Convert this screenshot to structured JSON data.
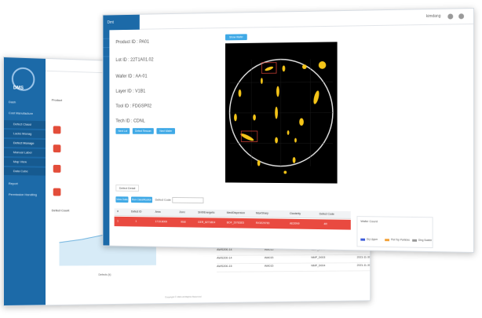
{
  "back_window": {
    "logo_text": "DMS",
    "nav": [
      {
        "label": "Dash"
      },
      {
        "label": "Cost Manufacture",
        "selected": false
      },
      {
        "label": "Defect Classi"
      },
      {
        "label": "Lacks Manag"
      },
      {
        "label": "Defect Manage",
        "selected": true
      },
      {
        "label": "Manual Label"
      },
      {
        "label": "Map View"
      },
      {
        "label": "Data Cube"
      },
      {
        "label": "Report"
      },
      {
        "label": "Permission Handling"
      }
    ],
    "panel_title": "Product",
    "chart_label": "Defect Count",
    "x_axis_label": "Defects (k)",
    "rows": [
      [
        "AWS200-10",
        "WA015",
        "NMP_D001",
        "2021-11-30 15:29:01"
      ],
      [
        "AWS200-14",
        "WA015",
        "NMP_D002",
        "2021-11-30 15:29:03"
      ],
      [
        "AWS200-14",
        "WA015",
        "NMP_D003",
        "2021-11-30 15:29:08"
      ],
      [
        "AWS200-15",
        "WA015",
        "NMP_D004",
        "2021-11-30 15:29:22"
      ]
    ],
    "footer": "Copyright © 2021 All Rights Reserved"
  },
  "front_window": {
    "brand": "Dmt",
    "user": "kimdang",
    "fields": [
      "Product ID : PA01",
      "Lot ID : 22T1A01.02",
      "Wafer ID : AA-01",
      "Layer ID : V1B1",
      "Tool ID : FDGSP02",
      "Tech ID : CDNL"
    ],
    "top_button": "Show Wafer",
    "buttons": [
      "Next Lot",
      "Defect Rescan",
      "Next Wafer"
    ],
    "tab_label": "Defect Detail",
    "filter_buttons": [
      "View Data",
      "Run Classification"
    ],
    "filter_label": "Defect Code",
    "table_headers": [
      "#",
      "Defect ID",
      "Area",
      "Zone",
      "Shift/Energetic",
      "Med/Dispersion",
      "Max/Sharp",
      "Clusterity",
      "Defect Code"
    ],
    "selected_row": [
      "1",
      "1",
      "1719.8000",
      "90/8",
      "GER_82718E4",
      "BOF_29783E5",
      "R/GE29783",
      "AE20N9",
      "4R"
    ],
    "wafer_chart_title": "Wafer Count",
    "legend": [
      {
        "label": "Dry Upper",
        "color": "#3d5bd9"
      },
      {
        "label": "Plot Top Particles",
        "color": "#f2a23a"
      },
      {
        "label": "Ding Scatter",
        "color": "#999999"
      }
    ]
  }
}
